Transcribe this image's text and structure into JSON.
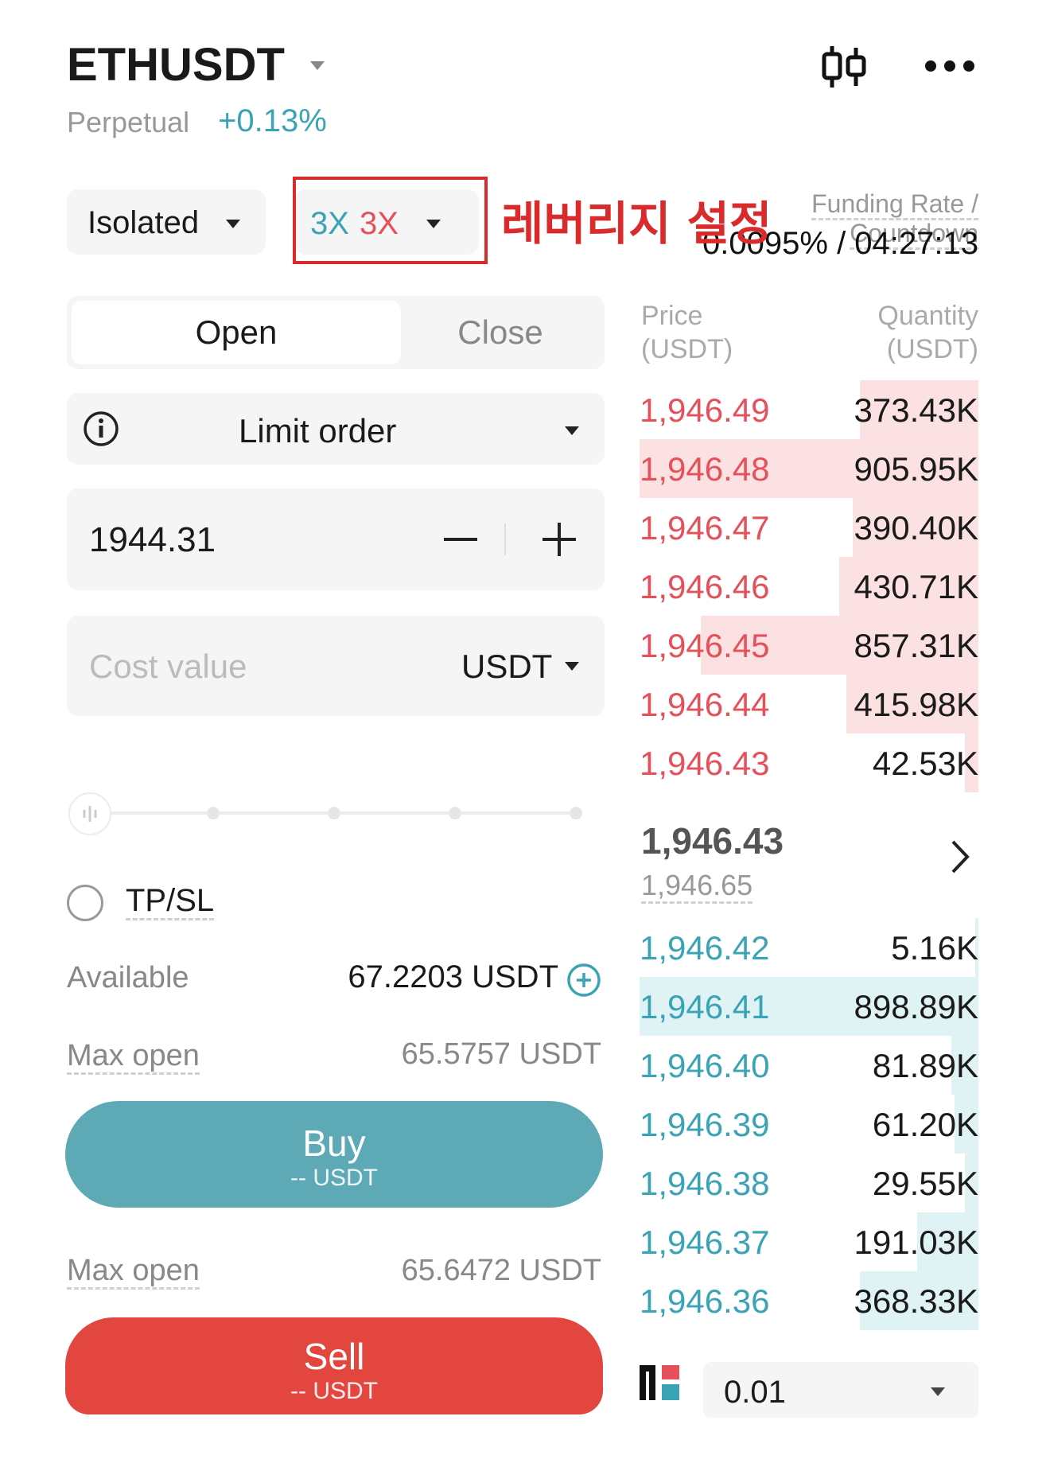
{
  "header": {
    "symbol": "ETHUSDT",
    "contract_type": "Perpetual",
    "change_pct": "+0.13%"
  },
  "controls": {
    "margin_mode": "Isolated",
    "leverage_long": "3X",
    "leverage_short": "3X",
    "annotation": "레버리지 설정"
  },
  "funding": {
    "label": "Funding Rate / Countdown",
    "value": "0.0095% / 04:27:13"
  },
  "tabs": {
    "open": "Open",
    "close": "Close"
  },
  "order": {
    "type": "Limit order",
    "price": "1944.31",
    "cost_placeholder": "Cost value",
    "cost_currency": "USDT",
    "tpsl_label": "TP/SL",
    "available_label": "Available",
    "available_value": "67.2203 USDT",
    "max_open_label": "Max open",
    "max_open_buy": "65.5757 USDT",
    "max_open_sell": "65.6472 USDT",
    "buy_label": "Buy",
    "buy_sub": "-- USDT",
    "sell_label": "Sell",
    "sell_sub": "-- USDT"
  },
  "orderbook": {
    "price_header_1": "Price",
    "price_header_2": "(USDT)",
    "qty_header_1": "Quantity",
    "qty_header_2": "(USDT)",
    "asks": [
      {
        "price": "1,946.49",
        "qty": "373.43K",
        "depth": 0.35
      },
      {
        "price": "1,946.48",
        "qty": "905.95K",
        "depth": 1.0
      },
      {
        "price": "1,946.47",
        "qty": "390.40K",
        "depth": 0.37
      },
      {
        "price": "1,946.46",
        "qty": "430.71K",
        "depth": 0.41
      },
      {
        "price": "1,946.45",
        "qty": "857.31K",
        "depth": 0.82
      },
      {
        "price": "1,946.44",
        "qty": "415.98K",
        "depth": 0.39
      },
      {
        "price": "1,946.43",
        "qty": "42.53K",
        "depth": 0.04
      }
    ],
    "last_price": "1,946.43",
    "mark_price": "1,946.65",
    "bids": [
      {
        "price": "1,946.42",
        "qty": "5.16K",
        "depth": 0.01
      },
      {
        "price": "1,946.41",
        "qty": "898.89K",
        "depth": 1.0
      },
      {
        "price": "1,946.40",
        "qty": "81.89K",
        "depth": 0.08
      },
      {
        "price": "1,946.39",
        "qty": "61.20K",
        "depth": 0.07
      },
      {
        "price": "1,946.38",
        "qty": "29.55K",
        "depth": 0.04
      },
      {
        "price": "1,946.37",
        "qty": "191.03K",
        "depth": 0.18
      },
      {
        "price": "1,946.36",
        "qty": "368.33K",
        "depth": 0.35
      }
    ],
    "tick_size": "0.01"
  },
  "colors": {
    "positive": "#3aa3b5",
    "negative": "#e6505a",
    "buy_button": "#5ea9b6",
    "sell_button": "#e3463f",
    "annotation_red": "#d92b2b"
  }
}
